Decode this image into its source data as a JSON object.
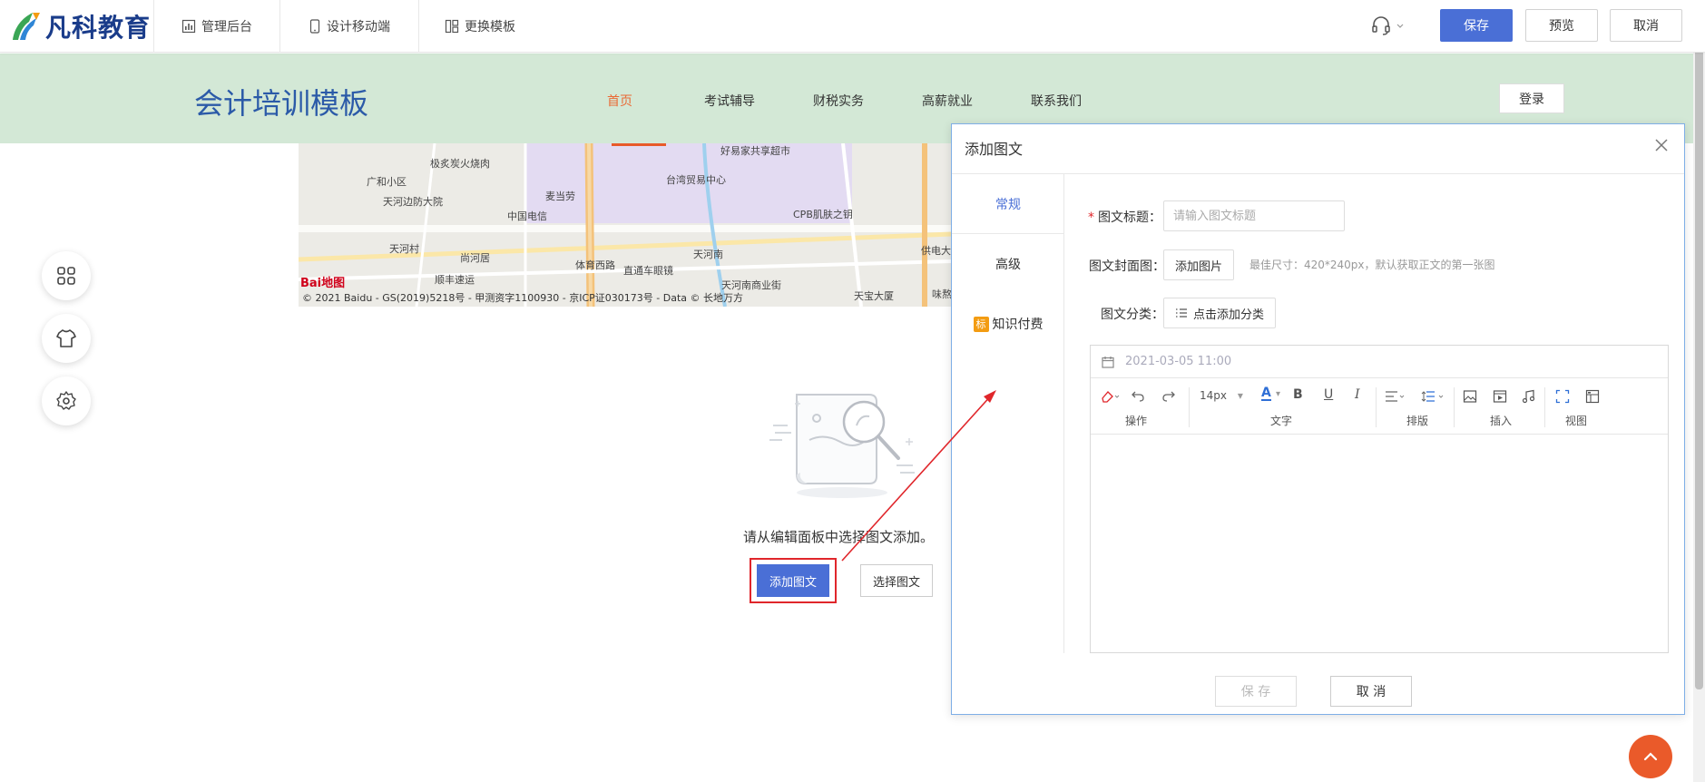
{
  "topbar": {
    "brand": "凡科教育",
    "nav": [
      {
        "label": "管理后台",
        "icon": "chart-icon"
      },
      {
        "label": "设计移动端",
        "icon": "mobile-icon"
      },
      {
        "label": "更换模板",
        "icon": "template-icon"
      }
    ],
    "save_label": "保存",
    "preview_label": "预览",
    "cancel_label": "取消"
  },
  "template": {
    "title": "会计培训模板",
    "nav": [
      "首页",
      "考试辅导",
      "财税实务",
      "高薪就业",
      "联系我们"
    ],
    "active_nav": "首页",
    "login_label": "登录"
  },
  "map": {
    "labels": [
      "好易家共享超市",
      "极炙炭火烧肉",
      "台湾贸易中心",
      "广和小区",
      "麦当劳",
      "天河边防大院",
      "中国电信",
      "CPB肌肤之钥",
      "天河村",
      "尚河居",
      "体育西路",
      "天河南",
      "直通车眼镜",
      "供电大",
      "顺丰速运",
      "天河南商业街",
      "天宝大厦",
      "味熬"
    ],
    "copyright": "© 2021 Baidu - GS(2019)5218号 - 甲测资字1100930 - 京ICP证030173号 - Data © 长地万方",
    "logo": "Bai地图"
  },
  "empty": {
    "message": "请从编辑面板中选择图文添加。",
    "add_label": "添加图文",
    "select_label": "选择图文"
  },
  "modal": {
    "title": "添加图文",
    "tabs": [
      "常规",
      "高级",
      "知识付费"
    ],
    "tab_badge": "标",
    "form": {
      "title_label": "图文标题：",
      "title_placeholder": "请输入图文标题",
      "cover_label": "图文封面图：",
      "cover_button": "添加图片",
      "cover_hint": "最佳尺寸：420*240px，默认获取正文的第一张图",
      "category_label": "图文分类：",
      "category_button": "点击添加分类"
    },
    "editor": {
      "date": "2021-03-05 11:00",
      "font_size": "14px",
      "groups": [
        "操作",
        "文字",
        "排版",
        "插入",
        "视图"
      ]
    },
    "save_label": "保 存",
    "cancel_label": "取 消"
  },
  "colors": {
    "primary": "#4a6fd6",
    "accent_orange": "#ea6a35",
    "header_green": "#d3e8d6",
    "highlight_red": "#e0262b"
  }
}
